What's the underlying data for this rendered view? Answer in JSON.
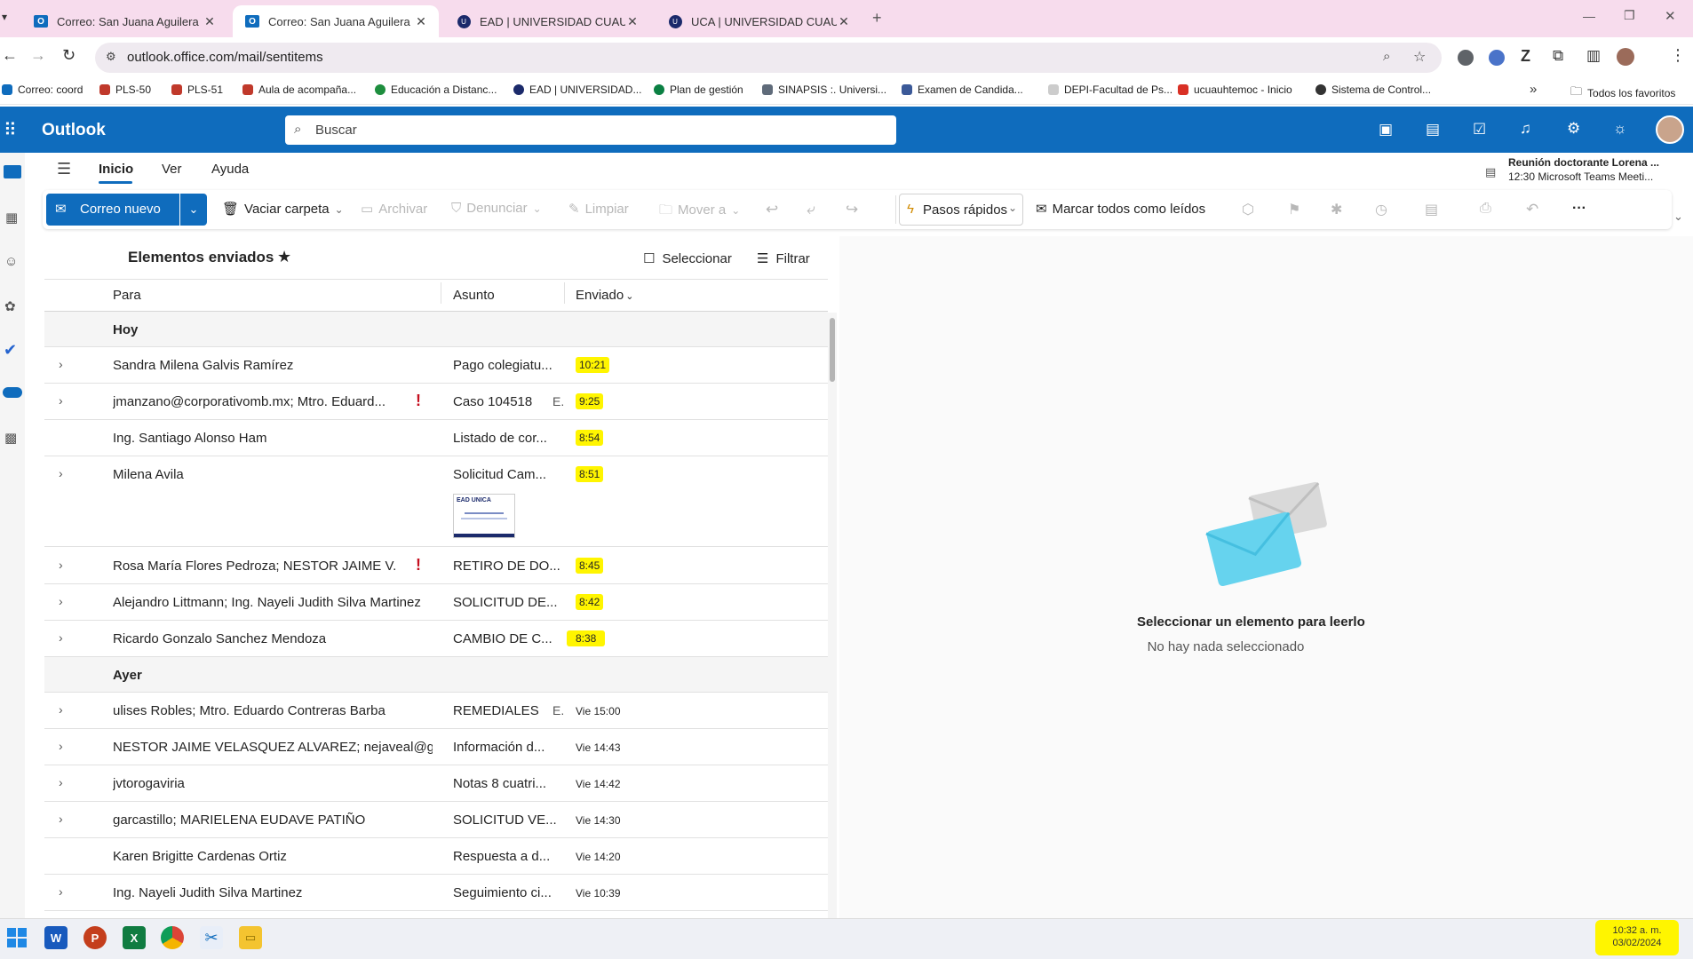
{
  "browser": {
    "tabs": [
      {
        "title": "Correo: San Juana Aguilera Rub",
        "icon": "outlook-icon"
      },
      {
        "title": "Correo: San Juana Aguilera Rub",
        "icon": "outlook-icon"
      },
      {
        "title": "EAD | UNIVERSIDAD CUAUHTÉMOC",
        "icon": "uca-icon"
      },
      {
        "title": "UCA | UNIVERSIDAD CUAUHTÉMOC",
        "icon": "uca-icon"
      }
    ],
    "url": "outlook.office.com/mail/sentitems",
    "bookmarks": [
      {
        "label": "Correo: coord",
        "color": "#0f6cbd"
      },
      {
        "label": "PLS-50",
        "color": "#c0392b"
      },
      {
        "label": "PLS-51",
        "color": "#c0392b"
      },
      {
        "label": "Aula de acompaña...",
        "color": "#c0392b"
      },
      {
        "label": "Educación a Distanc...",
        "color": "#1e8e3e"
      },
      {
        "label": "EAD | UNIVERSIDAD...",
        "color": "#1b2a6b"
      },
      {
        "label": "Plan de gestión",
        "color": "#0b8043"
      },
      {
        "label": "SINAPSIS :. Universi...",
        "color": "#5f6b7a"
      },
      {
        "label": "Examen de Candida...",
        "color": "#3b5998"
      },
      {
        "label": "DEPI-Facultad de Ps...",
        "color": "#cccccc"
      },
      {
        "label": "ucuauhtemoc - Inicio",
        "color": "#d93025"
      },
      {
        "label": "Sistema de Control...",
        "color": "#333333"
      }
    ],
    "all_favorites": "Todos los favoritos"
  },
  "outlook": {
    "app_name": "Outlook",
    "search_placeholder": "Buscar",
    "meeting_title": "Reunión doctorante Lorena ...",
    "meeting_detail": "12:30 Microsoft Teams Meeti...",
    "tabs": [
      "Inicio",
      "Ver",
      "Ayuda"
    ]
  },
  "ribbon": {
    "new_mail": "Correo nuevo",
    "empty_folder": "Vaciar carpeta",
    "archive": "Archivar",
    "report": "Denunciar",
    "sweep": "Limpiar",
    "move_to": "Mover a",
    "quick_steps": "Pasos rápidos",
    "mark_all_read": "Marcar todos como leídos"
  },
  "folder": {
    "title": "Elementos enviados",
    "select": "Seleccionar",
    "filter": "Filtrar",
    "col_to": "Para",
    "col_subject": "Asunto",
    "col_sent": "Enviado"
  },
  "groups": {
    "today": "Hoy",
    "yesterday": "Ayer"
  },
  "today_rows": [
    {
      "to": "Sandra Milena Galvis Ramírez",
      "subject": "Pago colegiatu...",
      "time": "10:21",
      "chevron": true,
      "important": false
    },
    {
      "to": "jmanzano@corporativomb.mx; Mtro. Eduard...",
      "subject": "Caso 104518",
      "time": "9:25",
      "chevron": true,
      "important": true
    },
    {
      "to": "Ing. Santiago Alonso Ham",
      "subject": "Listado de cor...",
      "time": "8:54",
      "chevron": false,
      "important": false
    },
    {
      "to": "Milena Avila",
      "subject": "Solicitud Cam...",
      "time": "8:51",
      "chevron": true,
      "important": false
    },
    {
      "to": "Rosa María Flores Pedroza; NESTOR JAIME V...",
      "subject": "RETIRO DE DO...",
      "time": "8:45",
      "chevron": true,
      "important": true
    },
    {
      "to": "Alejandro Littmann; Ing. Nayeli Judith Silva Martinez",
      "subject": "SOLICITUD DE...",
      "time": "8:42",
      "chevron": true,
      "important": false
    },
    {
      "to": "Ricardo Gonzalo Sanchez Mendoza",
      "subject": "CAMBIO DE C...",
      "time": "8:38",
      "chevron": true,
      "important": false
    }
  ],
  "yesterday_rows": [
    {
      "to": "ulises Robles; Mtro. Eduardo Contreras Barba",
      "subject": "REMEDIALES",
      "time": "Vie 15:00",
      "chevron": true
    },
    {
      "to": "NESTOR JAIME VELASQUEZ ALVAREZ; nejaveal@g...",
      "subject": "Información d...",
      "time": "Vie 14:43",
      "chevron": true
    },
    {
      "to": "jvtorogaviria",
      "subject": "Notas 8 cuatri...",
      "time": "Vie 14:42",
      "chevron": true
    },
    {
      "to": "garcastillo; MARIELENA EUDAVE PATIÑO",
      "subject": "SOLICITUD VE...",
      "time": "Vie 14:30",
      "chevron": true
    },
    {
      "to": "Karen Brigitte Cardenas Ortiz",
      "subject": "Respuesta a d...",
      "time": "Vie 14:20",
      "chevron": false
    },
    {
      "to": "Ing. Nayeli Judith Silva Martinez",
      "subject": "Seguimiento ci...",
      "time": "Vie 10:39",
      "chevron": true
    }
  ],
  "attachment_preview_label": "EAD UNICA",
  "reading_pane": {
    "title": "Seleccionar un elemento para leerlo",
    "subtitle": "No hay nada seleccionado"
  },
  "taskbar": {
    "time": "10:32 a. m.",
    "date": "03/02/2024",
    "apps": [
      "start-icon",
      "word-icon",
      "powerpoint-icon",
      "excel-icon",
      "chrome-icon",
      "snipping-icon",
      "file-explorer-icon"
    ]
  },
  "colors": {
    "accent": "#0f6cbd",
    "highlight": "#fff500",
    "tabbar": "#f7dced"
  }
}
